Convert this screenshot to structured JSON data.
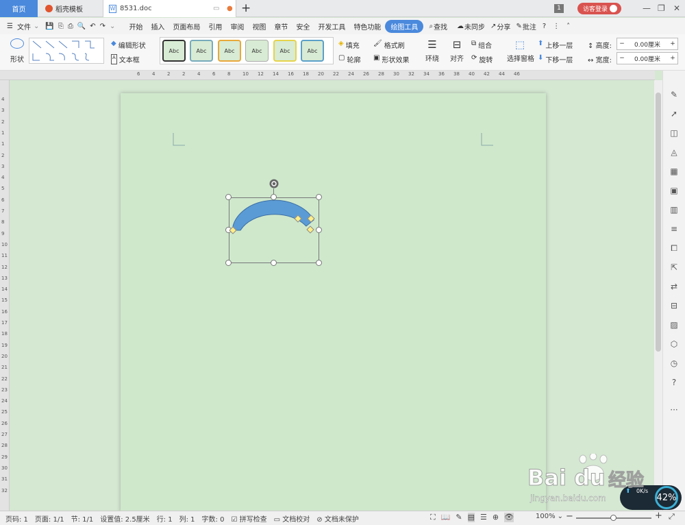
{
  "tabs": {
    "home": "首页",
    "daoke": "稻壳模板",
    "doc": "8531.doc",
    "add": "+"
  },
  "titlebar": {
    "badge": "1",
    "login": "访客登录"
  },
  "menu": {
    "file": "文件",
    "items": [
      "开始",
      "插入",
      "页面布局",
      "引用",
      "审阅",
      "视图",
      "章节",
      "安全",
      "开发工具",
      "特色功能"
    ],
    "active": "绘图工具",
    "search": "查找",
    "sync": "未同步",
    "share": "分享",
    "comment": "批注"
  },
  "ribbon": {
    "shape": "形状",
    "edit_shape": "编辑形状",
    "textbox": "文本框",
    "style_label": "Abc",
    "fill": "填充",
    "format_painter": "格式刷",
    "outline": "轮廓",
    "shape_effect": "形状效果",
    "wrap": "环绕",
    "align": "对齐",
    "group": "组合",
    "rotate": "旋转",
    "select_pane": "选择窗格",
    "bring_forward": "上移一层",
    "send_backward": "下移一层",
    "height_label": "高度:",
    "height_value": "0.00厘米",
    "width_label": "宽度:",
    "width_value": "0.00厘米"
  },
  "ruler_h": [
    "6",
    "4",
    "2",
    "2",
    "4",
    "6",
    "8",
    "10",
    "12",
    "14",
    "16",
    "18",
    "20",
    "22",
    "24",
    "26",
    "28",
    "30",
    "32",
    "34",
    "36",
    "38",
    "40",
    "42",
    "44",
    "46"
  ],
  "ruler_v": [
    "4",
    "3",
    "2",
    "1",
    "1",
    "2",
    "3",
    "4",
    "5",
    "6",
    "7",
    "8",
    "9",
    "10",
    "11",
    "12",
    "13",
    "14",
    "15",
    "16",
    "17",
    "18",
    "19",
    "20",
    "21",
    "22",
    "23",
    "24",
    "25",
    "26",
    "27",
    "28",
    "29",
    "30",
    "31",
    "32"
  ],
  "status": {
    "page_no": "页码: 1",
    "pages": "页面: 1/1",
    "section": "节: 1/1",
    "setting": "设置值: 2.5厘米",
    "row": "行: 1",
    "col": "列: 1",
    "words": "字数: 0",
    "spell": "拼写检查",
    "proof": "文档校对",
    "protect": "文档未保护",
    "zoom": "100%"
  },
  "speed": {
    "rate": "0K/s",
    "percent": "42%"
  },
  "watermark": {
    "brand": "Bai",
    "brand2": "du",
    "cn": "经验",
    "url": "jingyan.baidu.com"
  },
  "colors": {
    "accent": "#4a89dc",
    "page": "#cfe8cc",
    "arc": "#5b9bd5"
  }
}
